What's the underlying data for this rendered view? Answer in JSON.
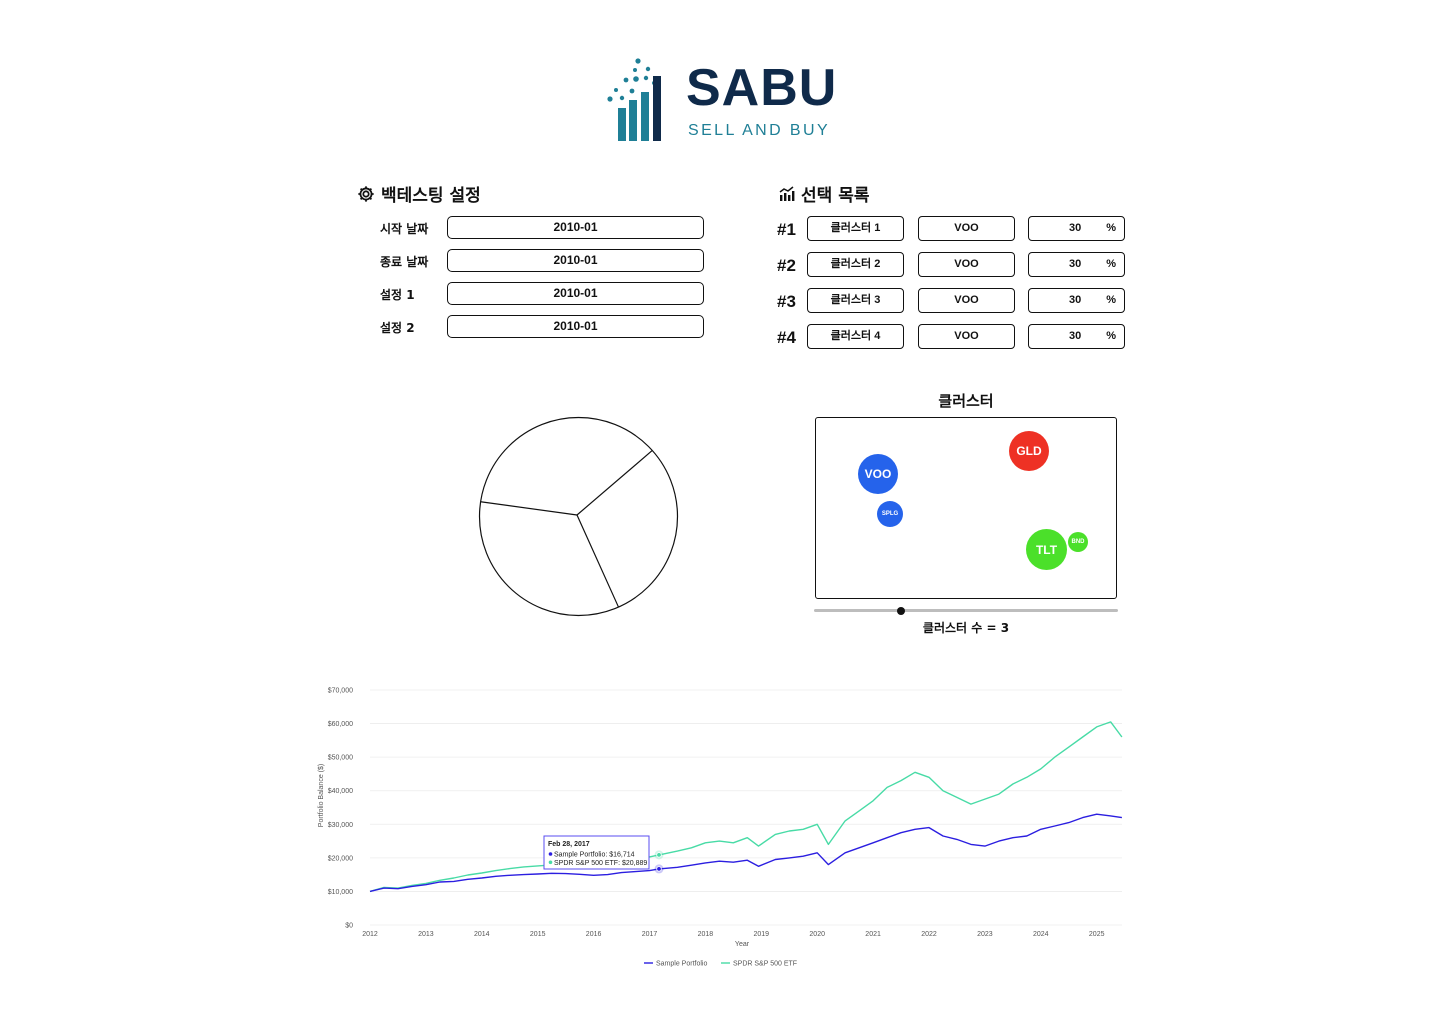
{
  "brand": {
    "name": "SABU",
    "tagline": "SELL AND BUY",
    "colors": {
      "navy": "#0f2a4a",
      "teal": "#1f7f96"
    }
  },
  "settings": {
    "title": "백테스팅 설정",
    "icon": "gear-icon",
    "fields": [
      {
        "label": "시작 날짜",
        "value": "2010-01"
      },
      {
        "label": "종료 날짜",
        "value": "2010-01"
      },
      {
        "label": "설정 1",
        "value": "2010-01"
      },
      {
        "label": "설정 2",
        "value": "2010-01"
      }
    ]
  },
  "selection": {
    "title": "선택 목록",
    "icon": "chart-icon",
    "rows": [
      {
        "num": "#1",
        "cluster": "클러스터 1",
        "ticker": "VOO",
        "pct": "30",
        "unit": "%"
      },
      {
        "num": "#2",
        "cluster": "클러스터 2",
        "ticker": "VOO",
        "pct": "30",
        "unit": "%"
      },
      {
        "num": "#3",
        "cluster": "클러스터 3",
        "ticker": "VOO",
        "pct": "30",
        "unit": "%"
      },
      {
        "num": "#4",
        "cluster": "클러스터 4",
        "ticker": "VOO",
        "pct": "30",
        "unit": "%"
      }
    ]
  },
  "pie": {
    "slices": [
      0.3,
      0.34,
      0.36
    ]
  },
  "cluster": {
    "title": "클러스터",
    "bubbles": [
      {
        "label": "VOO",
        "color": "#2563eb"
      },
      {
        "label": "SPLG",
        "color": "#2563eb"
      },
      {
        "label": "GLD",
        "color": "#ee3124"
      },
      {
        "label": "TLT",
        "color": "#4be02a"
      },
      {
        "label": "BND",
        "color": "#4be02a"
      }
    ],
    "slider_label": "클러스터 수 = 3",
    "slider_value": 3
  },
  "chart_data": {
    "type": "line",
    "title": "",
    "xlabel": "Year",
    "ylabel": "Portfolio Balance ($)",
    "x_ticks": [
      "2012",
      "2013",
      "2014",
      "2015",
      "2016",
      "2017",
      "2018",
      "2019",
      "2020",
      "2021",
      "2022",
      "2023",
      "2024",
      "2025"
    ],
    "y_ticks": [
      "$0",
      "$10,000",
      "$20,000",
      "$30,000",
      "$40,000",
      "$50,000",
      "$60,000",
      "$70,000"
    ],
    "xlim": [
      2012,
      2025.5
    ],
    "ylim": [
      0,
      70000
    ],
    "grid": true,
    "legend_position": "bottom",
    "series": [
      {
        "name": "Sample Portfolio",
        "color": "#2b1ee0",
        "x": [
          2012,
          2012.25,
          2012.5,
          2012.75,
          2013,
          2013.25,
          2013.5,
          2013.75,
          2014,
          2014.25,
          2014.5,
          2014.75,
          2015,
          2015.25,
          2015.5,
          2015.75,
          2016,
          2016.25,
          2016.5,
          2016.75,
          2017,
          2017.17,
          2017.5,
          2017.75,
          2018,
          2018.25,
          2018.5,
          2018.75,
          2018.95,
          2019.25,
          2019.5,
          2019.75,
          2020,
          2020.2,
          2020.5,
          2020.75,
          2021,
          2021.25,
          2021.5,
          2021.75,
          2022,
          2022.25,
          2022.5,
          2022.75,
          2023,
          2023.25,
          2023.5,
          2023.75,
          2024,
          2024.25,
          2024.5,
          2024.75,
          2025,
          2025.25,
          2025.45
        ],
        "y": [
          10000,
          11000,
          10800,
          11500,
          12000,
          12800,
          13000,
          13600,
          14000,
          14500,
          14800,
          15000,
          15200,
          15400,
          15300,
          15100,
          14800,
          15000,
          15600,
          15900,
          16200,
          16714,
          17200,
          17800,
          18500,
          19000,
          18700,
          19300,
          17500,
          19500,
          20000,
          20500,
          21500,
          18000,
          21500,
          23000,
          24500,
          26000,
          27500,
          28500,
          29000,
          26500,
          25500,
          24000,
          23500,
          25000,
          26000,
          26500,
          28500,
          29500,
          30500,
          32000,
          33000,
          32500,
          32000
        ]
      },
      {
        "name": "SPDR S&P 500 ETF",
        "color": "#48dba6",
        "x": [
          2012,
          2012.25,
          2012.5,
          2012.75,
          2013,
          2013.25,
          2013.5,
          2013.75,
          2014,
          2014.25,
          2014.5,
          2014.75,
          2015,
          2015.25,
          2015.5,
          2015.75,
          2016,
          2016.25,
          2016.5,
          2016.75,
          2017,
          2017.17,
          2017.5,
          2017.75,
          2018,
          2018.25,
          2018.5,
          2018.75,
          2018.95,
          2019.25,
          2019.5,
          2019.75,
          2020,
          2020.2,
          2020.5,
          2020.75,
          2021,
          2021.25,
          2021.5,
          2021.75,
          2022,
          2022.25,
          2022.5,
          2022.75,
          2023,
          2023.25,
          2023.5,
          2023.75,
          2024,
          2024.25,
          2024.5,
          2024.75,
          2025,
          2025.25,
          2025.45
        ],
        "y": [
          10000,
          11200,
          11000,
          11800,
          12400,
          13300,
          14000,
          14900,
          15500,
          16200,
          16800,
          17300,
          17600,
          17900,
          17700,
          17500,
          17200,
          18000,
          19000,
          19700,
          20300,
          20889,
          22000,
          23000,
          24500,
          25000,
          24500,
          26000,
          23500,
          27000,
          28000,
          28500,
          30000,
          24000,
          31000,
          34000,
          37000,
          41000,
          43000,
          45500,
          44000,
          40000,
          38000,
          36000,
          37500,
          39000,
          42000,
          44000,
          46500,
          50000,
          53000,
          56000,
          59000,
          60500,
          56000
        ]
      }
    ],
    "tooltip": {
      "title": "Feb 28, 2017",
      "lines": [
        "Sample Portfolio: $16,714",
        "SPDR S&P 500 ETF: $20,889"
      ],
      "x": 2017.17
    }
  }
}
